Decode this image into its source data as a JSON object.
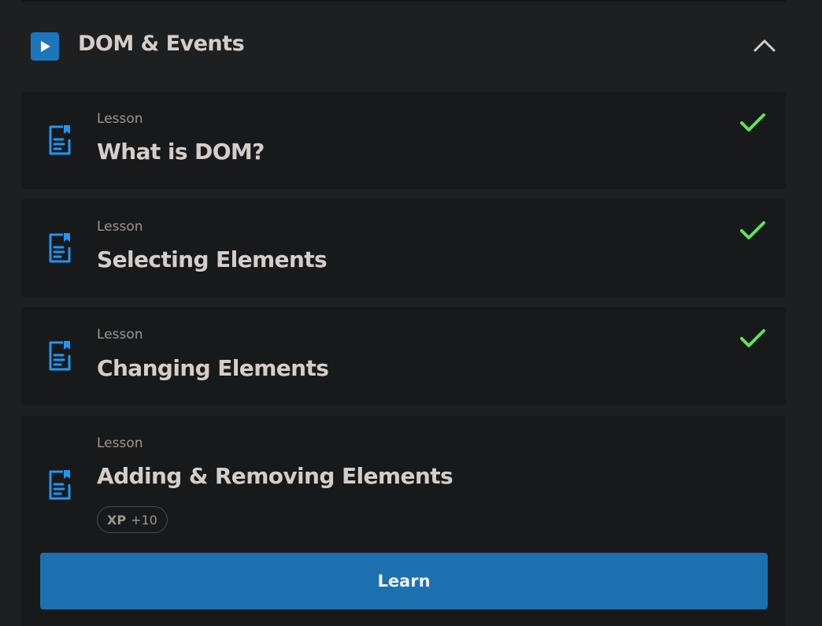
{
  "section": {
    "title": "DOM & Events",
    "accent": "#1d75bc"
  },
  "lessons": [
    {
      "kicker": "Lesson",
      "title": "What is DOM?",
      "completed": true
    },
    {
      "kicker": "Lesson",
      "title": "Selecting Elements",
      "completed": true
    },
    {
      "kicker": "Lesson",
      "title": "Changing Elements",
      "completed": true
    },
    {
      "kicker": "Lesson",
      "title": "Adding & Removing Elements",
      "completed": false,
      "xp_label": "XP",
      "xp_value": "+10",
      "action_label": "Learn"
    }
  ],
  "icons": {
    "section": "play-icon",
    "collapse": "chevron-up-icon",
    "lesson": "lesson-document-icon",
    "completed": "checkmark-icon"
  },
  "colors": {
    "background": "#1e1f21",
    "card": "#18191b",
    "accent_blue": "#1d75bc",
    "check_green": "#5ee556",
    "text_primary": "#d3ceca",
    "text_secondary": "#9b9792"
  }
}
